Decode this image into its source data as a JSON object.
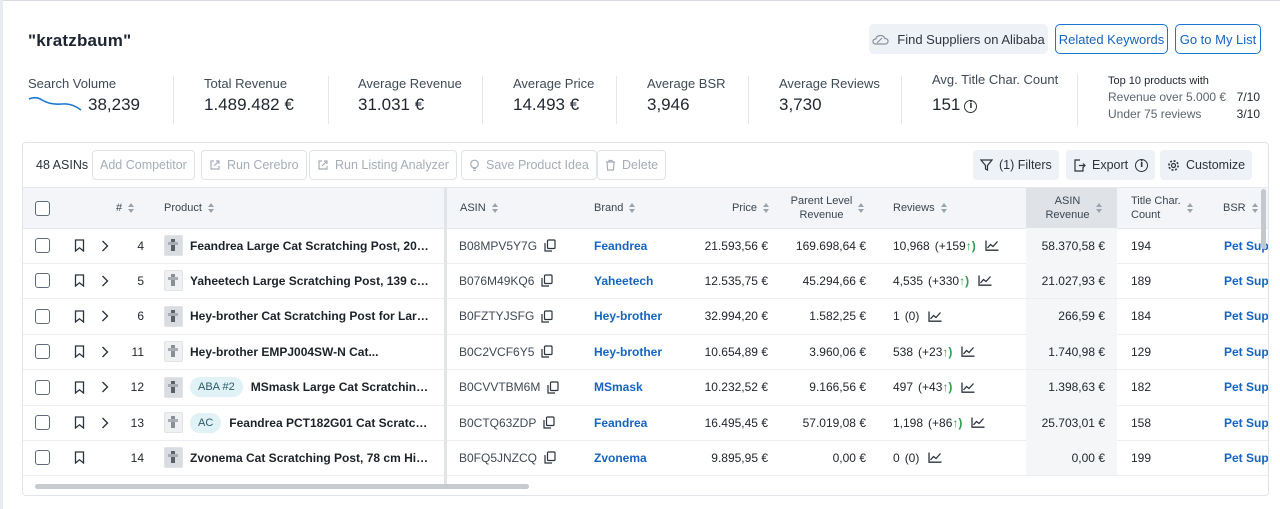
{
  "keyword_title": "\"kratzbaum\"",
  "header_buttons": {
    "alibaba": "Find Suppliers on Alibaba",
    "related": "Related Keywords",
    "mylist": "Go to My List"
  },
  "metrics": {
    "search_volume": {
      "label": "Search Volume",
      "value": "38,239"
    },
    "total_revenue": {
      "label": "Total Revenue",
      "value": "1.489.482 €"
    },
    "avg_revenue": {
      "label": "Average Revenue",
      "value": "31.031 €"
    },
    "avg_price": {
      "label": "Average Price",
      "value": "14.493 €"
    },
    "avg_bsr": {
      "label": "Average BSR",
      "value": "3,946"
    },
    "avg_reviews": {
      "label": "Average Reviews",
      "value": "3,730"
    },
    "avg_title": {
      "label": "Avg. Title Char. Count",
      "value": "151"
    },
    "top10": {
      "heading": "Top 10 products with",
      "revenue_label": "Revenue over 5.000 €",
      "revenue_value": "7/10",
      "reviews_label": "Under 75 reviews",
      "reviews_value": "3/10"
    }
  },
  "toolbar": {
    "asin_count": "48 ASINs",
    "add_competitor": "Add Competitor",
    "run_cerebro": "Run Cerebro",
    "run_listing": "Run Listing Analyzer",
    "save_idea": "Save Product Idea",
    "delete": "Delete",
    "filters": "(1) Filters",
    "export": "Export",
    "customize": "Customize"
  },
  "columns": {
    "num": "#",
    "product": "Product",
    "asin": "ASIN",
    "brand": "Brand",
    "price": "Price",
    "parent_rev_1": "Parent Level",
    "parent_rev_2": "Revenue",
    "reviews": "Reviews",
    "asin_rev_1": "ASIN",
    "asin_rev_2": "Revenue",
    "title_1": "Title Char.",
    "title_2": "Count",
    "bsr": "BSR"
  },
  "rows": [
    {
      "num": "4",
      "badge": "",
      "product": "Feandrea Large Cat Scratching Post, 206...",
      "asin": "B08MPV5Y7G",
      "brand": "Feandrea",
      "price": "21.593,56 €",
      "parent_revenue": "169.698,64 €",
      "reviews": "10,968",
      "reviews_delta": "(+159",
      "asin_revenue": "58.370,58 €",
      "title_count": "194",
      "bsr": "Pet Sup"
    },
    {
      "num": "5",
      "badge": "",
      "product": "Yaheetech Large Scratching Post, 139 cm...",
      "asin": "B076M49KQ6",
      "brand": "Yaheetech",
      "price": "12.535,75 €",
      "parent_revenue": "45.294,66 €",
      "reviews": "4,535",
      "reviews_delta": "(+330",
      "asin_revenue": "21.027,93 €",
      "title_count": "189",
      "bsr": "Pet Sup"
    },
    {
      "num": "6",
      "badge": "",
      "product": "Hey-brother Cat Scratching Post for Larg...",
      "asin": "B0FZTYJSFG",
      "brand": "Hey-brother",
      "price": "32.994,20 €",
      "parent_revenue": "1.582,25 €",
      "reviews": "1",
      "reviews_delta": "(0)",
      "asin_revenue": "266,59 €",
      "title_count": "184",
      "bsr": "Pet Sup"
    },
    {
      "num": "11",
      "badge": "",
      "product": "Hey-brother EMPJ004SW-N Cat...",
      "asin": "B0C2VCF6Y5",
      "brand": "Hey-brother",
      "price": "10.654,89 €",
      "parent_revenue": "3.960,06 €",
      "reviews": "538",
      "reviews_delta": "(+23",
      "asin_revenue": "1.740,98 €",
      "title_count": "129",
      "bsr": "Pet Sup"
    },
    {
      "num": "12",
      "badge": "ABA #2",
      "product": "MSmask Large Cat Scratching...",
      "asin": "B0CVVTBM6M",
      "brand": "MSmask",
      "price": "10.232,52 €",
      "parent_revenue": "9.166,56 €",
      "reviews": "497",
      "reviews_delta": "(+43",
      "asin_revenue": "1.398,63 €",
      "title_count": "182",
      "bsr": "Pet Sup"
    },
    {
      "num": "13",
      "badge": "AC",
      "product": "Feandrea PCT182G01 Cat Scratchin...",
      "asin": "B0CTQ63ZDP",
      "brand": "Feandrea",
      "price": "16.495,45 €",
      "parent_revenue": "57.019,08 €",
      "reviews": "1,198",
      "reviews_delta": "(+86",
      "asin_revenue": "25.703,01 €",
      "title_count": "158",
      "bsr": "Pet Sup"
    },
    {
      "num": "14",
      "badge": "",
      "product": "Zvonema Cat Scratching Post, 78 cm Hig...",
      "asin": "B0FQ5JNZCQ",
      "brand": "Zvonema",
      "price": "9.895,95 €",
      "parent_revenue": "0,00 €",
      "reviews": "0",
      "reviews_delta": "(0)",
      "asin_revenue": "0,00 €",
      "title_count": "199",
      "bsr": "Pet Sup"
    }
  ]
}
